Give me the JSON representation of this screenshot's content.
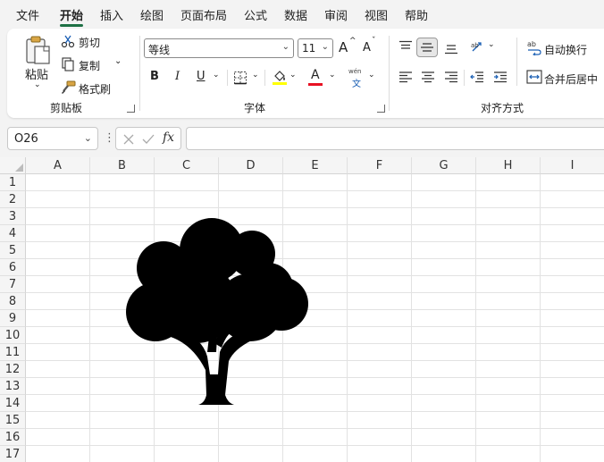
{
  "menu": {
    "file": "文件",
    "home": "开始",
    "insert": "插入",
    "draw": "绘图",
    "page_layout": "页面布局",
    "formulas": "公式",
    "data": "数据",
    "review": "审阅",
    "view": "视图",
    "help": "帮助"
  },
  "clipboard": {
    "paste": "粘贴",
    "cut": "剪切",
    "copy": "复制",
    "format_painter": "格式刷",
    "group_label": "剪贴板"
  },
  "font": {
    "font_name": "等线",
    "font_size": "11",
    "bold": "B",
    "italic": "I",
    "underline": "U",
    "font_color_letter": "A",
    "phonetic_top": "wén",
    "phonetic_bottom": "文",
    "grow": "A",
    "shrink": "A",
    "group_label": "字体",
    "highlight_color": "#ffff00",
    "font_color": "#e81123"
  },
  "alignment": {
    "wrap_text": "自动换行",
    "merge_center": "合并后居中",
    "group_label": "对齐方式"
  },
  "formula_bar": {
    "name_box": "O26",
    "fx": "fx",
    "value": ""
  },
  "sheet": {
    "columns": [
      "A",
      "B",
      "C",
      "D",
      "E",
      "F",
      "G",
      "H",
      "I"
    ],
    "rows": [
      "1",
      "2",
      "3",
      "4",
      "5",
      "6",
      "7",
      "8",
      "9",
      "10",
      "11",
      "12",
      "13",
      "14",
      "15",
      "16",
      "17"
    ],
    "shape": "tree-icon"
  }
}
